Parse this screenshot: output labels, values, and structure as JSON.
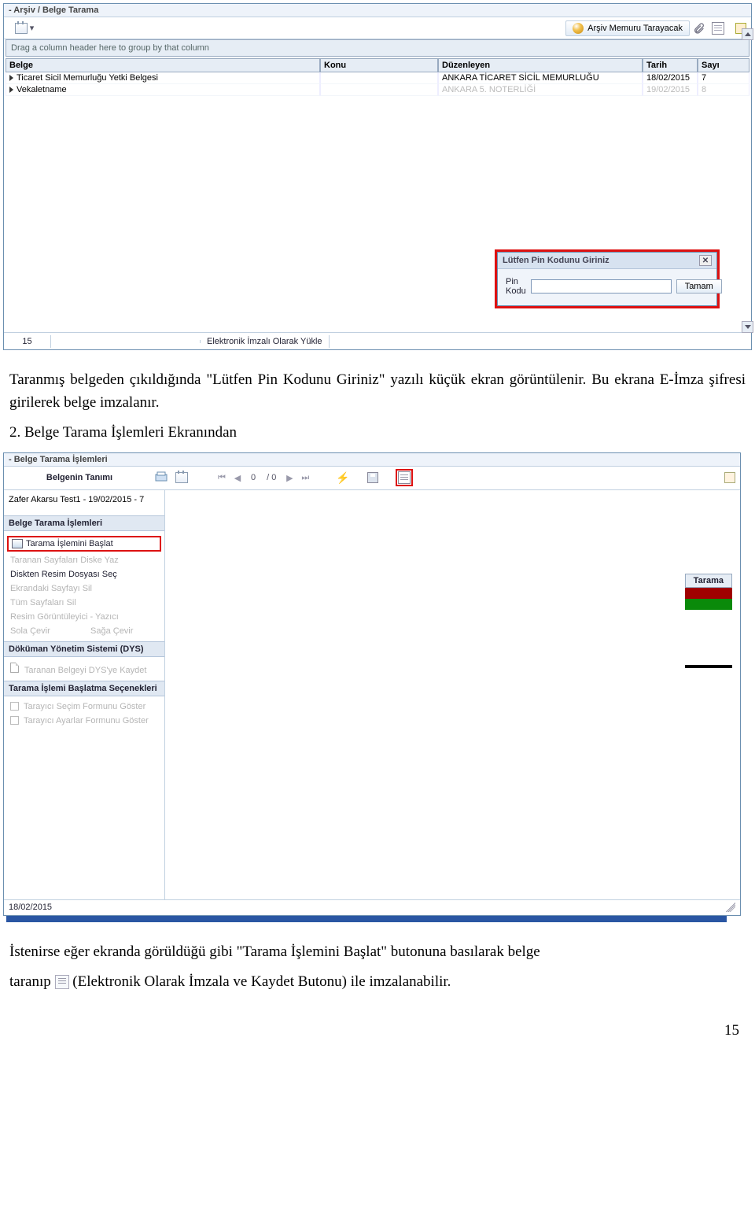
{
  "screenshot1": {
    "title": "- Arşiv / Belge Tarama",
    "group_hint": "Drag a column header here to group by that column",
    "toolbar": {
      "arsiv_memuru": "Arşiv Memuru Tarayacak"
    },
    "columns": {
      "belge": "Belge",
      "konu": "Konu",
      "duzenleyen": "Düzenleyen",
      "tarih": "Tarih",
      "sayi": "Sayı"
    },
    "rows": [
      {
        "belge": "Ticaret Sicil Memurluğu Yetki Belgesi",
        "konu": "",
        "duzenleyen": "ANKARA TİCARET SİCİL MEMURLUĞU",
        "tarih": "18/02/2015",
        "sayi": "7"
      },
      {
        "belge": "Vekaletname",
        "konu": "",
        "duzenleyen": "ANKARA 5. NOTERLİĞİ",
        "tarih": "19/02/2015",
        "sayi": "8"
      }
    ],
    "status": {
      "left": "15",
      "right": "Elektronik İmzalı Olarak Yükle"
    },
    "pin": {
      "title": "Lütfen Pin Kodunu Giriniz",
      "label": "Pin Kodu",
      "ok": "Tamam"
    }
  },
  "paragraph1": "Taranmış belgeden çıkıldığında \"Lütfen Pin Kodunu Giriniz\" yazılı küçük ekran görüntülenir. Bu ekrana E-İmza şifresi girilerek belge imzalanır.",
  "paragraph2": "2. Belge Tarama İşlemleri Ekranından",
  "screenshot2": {
    "title": "- Belge Tarama İşlemleri",
    "header_label": "Belgenin Tanımı",
    "doc_info": "Zafer Akarsu Test1 - 19/02/2015 - 7",
    "nav": {
      "cur": "0",
      "total": "/ 0"
    },
    "panels": {
      "scan_title": "Belge Tarama İşlemleri",
      "items": {
        "start": "Tarama İşlemini Başlat",
        "save_pages": "Taranan Sayfaları Diske Yaz",
        "select_image": "Diskten Resim Dosyası Seç",
        "del_page": "Ekrandaki Sayfayı Sil",
        "del_all": "Tüm Sayfaları Sil",
        "viewer": "Resim Görüntüleyici - Yazıcı",
        "rotate_left": "Sola Çevir",
        "rotate_right": "Sağa Çevir"
      },
      "dys_title": "Döküman Yönetim Sistemi (DYS)",
      "dys_item": "Taranan Belgeyi DYS'ye Kaydet",
      "opts_title": "Tarama İşlemi Başlatma Seçenekleri",
      "opt1": "Tarayıcı Seçim Formunu Göster",
      "opt2": "Tarayıcı Ayarlar Formunu Göster"
    },
    "right_badge": "Tarama",
    "status_date": "18/02/2015"
  },
  "paragraph3a": "İstenirse eğer ekranda görüldüğü gibi \"Tarama İşlemini Başlat\" butonuna basılarak belge",
  "paragraph3b_left": "taranıp ",
  "paragraph3b_right": " (Elektronik Olarak İmzala ve Kaydet Butonu) ile imzalanabilir.",
  "page_number": "15"
}
